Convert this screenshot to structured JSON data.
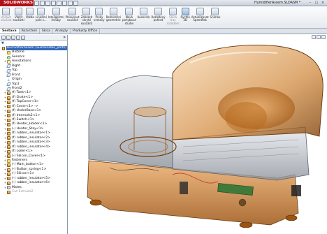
{
  "app": {
    "logo_text": "SOLIDWORKS",
    "document_title": "HumidifierAssem.SLDASM *",
    "window_controls": [
      "–",
      "□",
      "×"
    ]
  },
  "ribbon": {
    "buttons": [
      {
        "label": "Upravit\nsoučást",
        "dim": true
      },
      {
        "label": "Vložit\nsoučásti",
        "dim": false
      },
      {
        "label": "Vazba",
        "dim": false
      },
      {
        "label": "Lineární\npole s...",
        "dim": false
      },
      {
        "label": "Inteligentní\nšrouby",
        "dim": false
      },
      {
        "label": "Přesunout\nsoučást",
        "dim": false
      },
      {
        "label": "Zobrazit\nskryté\nsoučásti",
        "dim": false
      },
      {
        "label": "Prvky\nsestavy",
        "dim": false
      },
      {
        "label": "Referenční\ngeometrie",
        "dim": false
      },
      {
        "label": "Nová\npohybová\nstudie",
        "dim": false
      },
      {
        "label": "Kusovník",
        "dim": false
      },
      {
        "label": "Rozložený\npohled",
        "dim": false
      },
      {
        "label": "Skica\ntras\nrozložení",
        "dim": true
      },
      {
        "label": "Rychlé\n3D",
        "dim": false,
        "active": true
      },
      {
        "label": "Aktualizovat\nSpeedPak",
        "dim": false
      },
      {
        "label": "Snímek",
        "dim": false
      }
    ]
  },
  "tabs": [
    "Sestava",
    "Rozvržení",
    "Skica",
    "Analýzy",
    "Produkty Office"
  ],
  "filter_symbol": "▼",
  "tree": {
    "items": [
      {
        "label": "HumidifierAssem (Sustainable_parts)",
        "icon": "asm",
        "indent": 0,
        "exp": "-",
        "top": true
      },
      {
        "label": "Historie",
        "icon": "folder",
        "indent": 1,
        "exp": ""
      },
      {
        "label": "Sensors",
        "icon": "sensor",
        "indent": 1,
        "exp": ""
      },
      {
        "label": "Annotations",
        "icon": "note",
        "indent": 1,
        "exp": "+"
      },
      {
        "label": "Right",
        "icon": "plane",
        "indent": 1,
        "exp": ""
      },
      {
        "label": "Top",
        "icon": "plane",
        "indent": 1,
        "exp": ""
      },
      {
        "label": "Front",
        "icon": "plane",
        "indent": 1,
        "exp": ""
      },
      {
        "label": "Origin",
        "icon": "origin",
        "indent": 1,
        "exp": ""
      },
      {
        "label": "Top1",
        "icon": "plane",
        "indent": 1,
        "exp": ""
      },
      {
        "label": "Front2",
        "icon": "plane",
        "indent": 1,
        "exp": ""
      },
      {
        "label": "(f) Tank<1>",
        "icon": "part",
        "indent": 1,
        "exp": "+"
      },
      {
        "label": "(f) Grate<1>",
        "icon": "part",
        "indent": 1,
        "exp": "+"
      },
      {
        "label": "(f) TopCover<1>",
        "icon": "part",
        "indent": 1,
        "exp": "+"
      },
      {
        "label": "(f) Cover<1> -> ",
        "icon": "part",
        "indent": 1,
        "exp": "+"
      },
      {
        "label": "(f) UnderBase<1>",
        "icon": "part",
        "indent": 1,
        "exp": "+"
      },
      {
        "label": "(f) Internals2<1>",
        "icon": "part",
        "indent": 1,
        "exp": "+"
      },
      {
        "label": "(f) Switch<1>",
        "icon": "part",
        "indent": 1,
        "exp": "+"
      },
      {
        "label": "(f) Heater_Holder<1>",
        "icon": "part",
        "indent": 1,
        "exp": "+"
      },
      {
        "label": "(-) Heater_Stay<1>",
        "icon": "part",
        "indent": 1,
        "exp": "+"
      },
      {
        "label": "(f) rubber_insulator<1>",
        "icon": "part",
        "indent": 1,
        "exp": "+"
      },
      {
        "label": "(f) rubber_insulator<2>",
        "icon": "part",
        "indent": 1,
        "exp": "+"
      },
      {
        "label": "(f) rubber_insulator<3>",
        "icon": "part",
        "indent": 1,
        "exp": "+"
      },
      {
        "label": "(f) rubber_insulator<4>",
        "icon": "part",
        "indent": 1,
        "exp": "+"
      },
      {
        "label": "(f) coiler<1>",
        "icon": "part",
        "indent": 1,
        "exp": "+"
      },
      {
        "label": "(-) Silicon_Cover<1>",
        "icon": "part",
        "indent": 1,
        "exp": "+"
      },
      {
        "label": "Fasteners",
        "icon": "folder",
        "indent": 1,
        "exp": "+"
      },
      {
        "label": "(-) Main_button<1>",
        "icon": "part",
        "indent": 1,
        "exp": "+"
      },
      {
        "label": "(-) Button_spring<1>",
        "icon": "part",
        "indent": 1,
        "exp": "+"
      },
      {
        "label": "(-) Silicon<1>",
        "icon": "part",
        "indent": 1,
        "exp": "+"
      },
      {
        "label": "(-) rubber_insulator<5>",
        "icon": "part",
        "indent": 1,
        "exp": "+"
      },
      {
        "label": "(-) rubber_insulator<6>",
        "icon": "part",
        "indent": 1,
        "exp": "+"
      },
      {
        "label": "Mates",
        "icon": "mates",
        "indent": 1,
        "exp": "+"
      },
      {
        "label": "Cut-Extrude2",
        "icon": "part",
        "indent": 1,
        "exp": "",
        "dim": true
      }
    ]
  },
  "colors": {
    "accent": "#3468b8",
    "model_orange": "#c87a2a",
    "model_shell": "#b9bec6"
  }
}
